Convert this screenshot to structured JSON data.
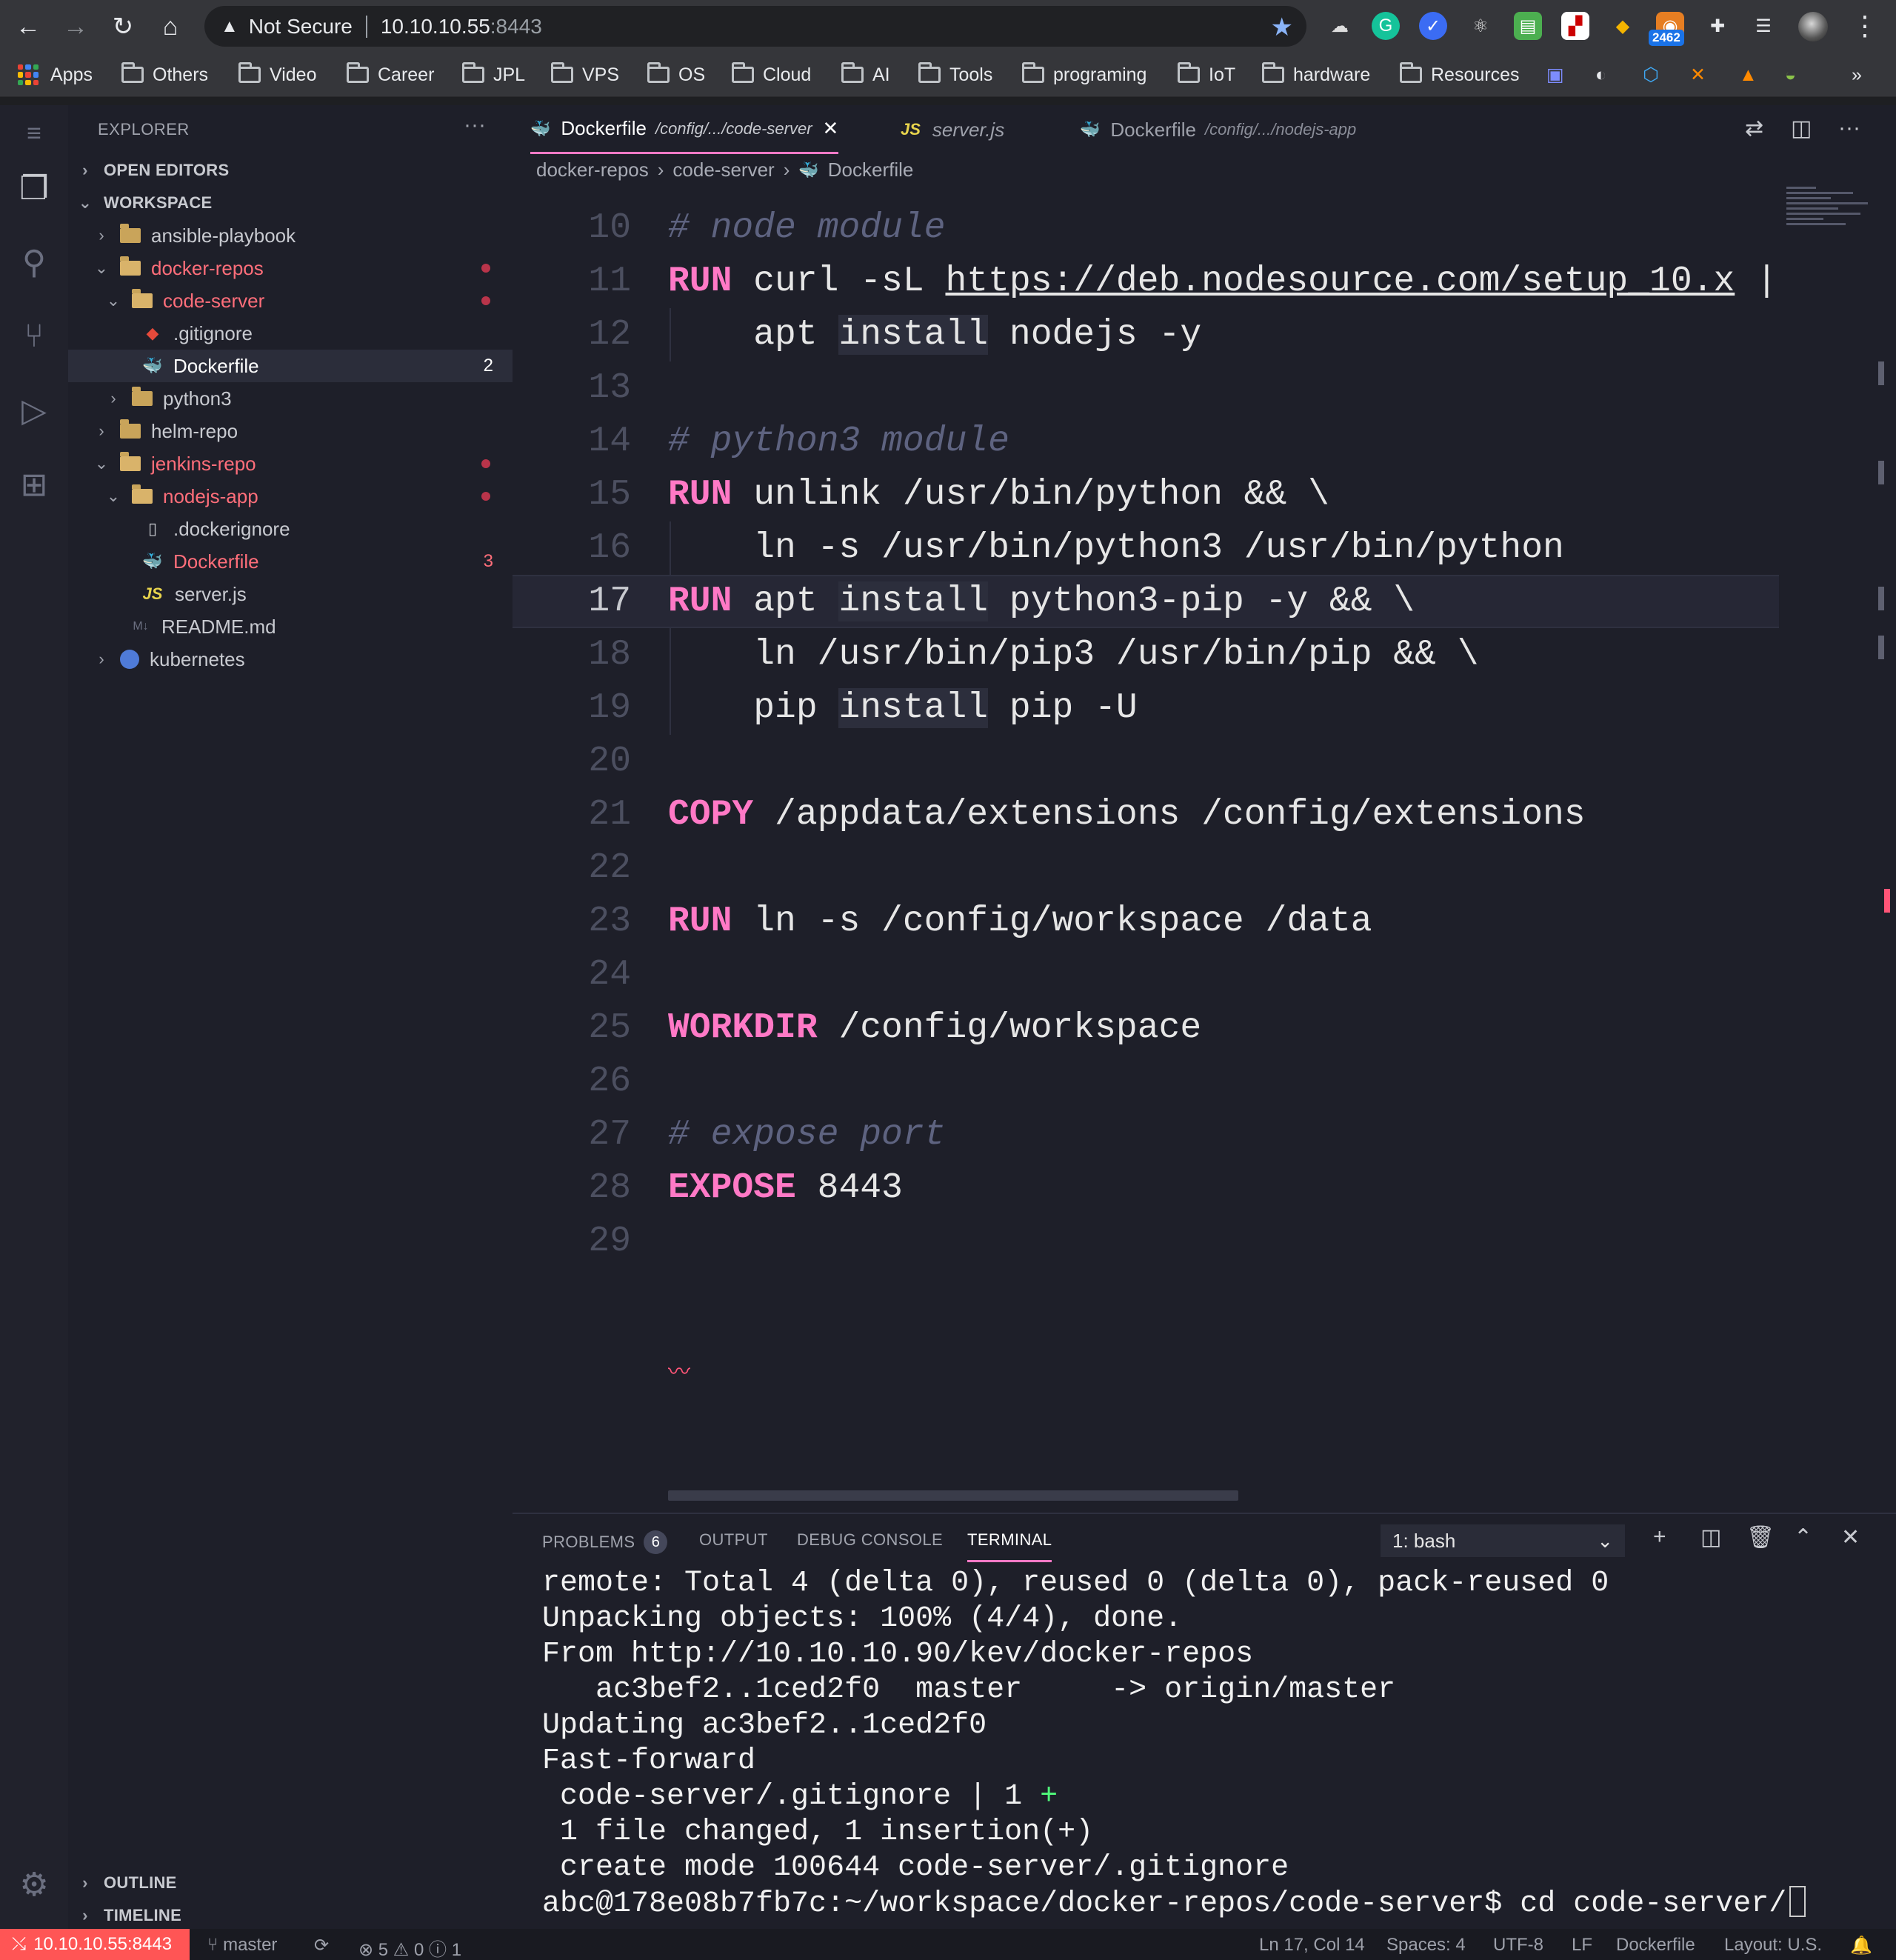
{
  "browser": {
    "security_label": "Not Secure",
    "host": "10.10.10.55",
    "port": ":8443",
    "extension_badge": "2462",
    "bookmarks": [
      "Apps",
      "Others",
      "Video",
      "Career",
      "JPL",
      "VPS",
      "OS",
      "Cloud",
      "AI",
      "Tools",
      "programing",
      "IoT",
      "hardware",
      "Resources"
    ],
    "more_bookmarks": "»"
  },
  "sidebar": {
    "title": "EXPLORER",
    "open_editors": "OPEN EDITORS",
    "workspace": "WORKSPACE",
    "tree": [
      {
        "label": "ansible-playbook"
      },
      {
        "label": "docker-repos"
      },
      {
        "label": "code-server"
      },
      {
        "label": ".gitignore"
      },
      {
        "label": "Dockerfile",
        "count": "2"
      },
      {
        "label": "python3"
      },
      {
        "label": "helm-repo"
      },
      {
        "label": "jenkins-repo"
      },
      {
        "label": "nodejs-app"
      },
      {
        "label": ".dockerignore"
      },
      {
        "label": "Dockerfile",
        "count": "3"
      },
      {
        "label": "server.js"
      },
      {
        "label": "README.md"
      },
      {
        "label": "kubernetes"
      }
    ],
    "outline": "OUTLINE",
    "timeline": "TIMELINE"
  },
  "tabs": [
    {
      "label": "Dockerfile",
      "path": "/config/.../code-server"
    },
    {
      "label": "server.js"
    },
    {
      "label": "Dockerfile",
      "path": "/config/.../nodejs-app"
    }
  ],
  "breadcrumb": [
    "docker-repos",
    "code-server",
    "Dockerfile"
  ],
  "code": {
    "line_numbers": [
      "10",
      "11",
      "12",
      "13",
      "14",
      "15",
      "16",
      "17",
      "18",
      "19",
      "20",
      "21",
      "22",
      "23",
      "24",
      "25",
      "26",
      "27",
      "28",
      "29"
    ],
    "l10": "# node module",
    "l11_kw": "RUN",
    "l11_a": " curl -sL ",
    "l11_url": "https://deb.nodesource.com/setup_10.x",
    "l11_b": " |",
    "l12_a": "    apt ",
    "l12_hl": "install",
    "l12_b": " nodejs -y",
    "l14": "# python3 module",
    "l15_kw": "RUN",
    "l15_a": " unlink /usr/bin/python && \\",
    "l16": "    ln -s /usr/bin/python3 /usr/bin/python",
    "l17_kw": "RUN",
    "l17_a": " apt ",
    "l17_hl": "install",
    "l17_b": " python3-pip -y && \\",
    "l18": "    ln /usr/bin/pip3 /usr/bin/pip && \\",
    "l19_a": "    pip ",
    "l19_hl": "install",
    "l19_b": " pip -U",
    "l21_kw": "COPY",
    "l21_a": " /appdata/extensions /config/extensions",
    "l23_kw": "RUN",
    "l23_a": " ln -s /config/workspace /data",
    "l25_kw": "WORKDIR",
    "l25_a": " /config/workspace",
    "l27": "# expose port",
    "l28_kw": "EXPOSE",
    "l28_a": " 8443"
  },
  "panel": {
    "tabs": [
      "PROBLEMS",
      "OUTPUT",
      "DEBUG CONSOLE",
      "TERMINAL"
    ],
    "problems_count": "6",
    "terminal_select": "1: bash",
    "terminal_lines": [
      "remote: Total 4 (delta 0), reused 0 (delta 0), pack-reused 0",
      "Unpacking objects: 100% (4/4), done.",
      "From http://10.10.10.90/kev/docker-repos",
      "   ac3bef2..1ced2f0  master     -> origin/master",
      "Updating ac3bef2..1ced2f0",
      "Fast-forward",
      " code-server/.gitignore | 1 ",
      " 1 file changed, 1 insertion(+)",
      " create mode 100644 code-server/.gitignore",
      "abc@178e08b7fb7c:~/workspace/docker-repos/code-server$ cd code-server/"
    ],
    "plus": "+"
  },
  "status": {
    "remote": "10.10.10.55:8443",
    "branch": "master",
    "errors": "5",
    "warnings": "0",
    "infos": "1",
    "position": "Ln 17, Col 14",
    "spaces": "Spaces: 4",
    "encoding": "UTF-8",
    "eol": "LF",
    "language": "Dockerfile",
    "layout": "Layout: U.S."
  }
}
